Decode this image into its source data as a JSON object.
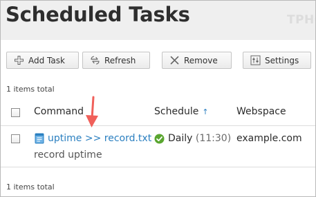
{
  "header": {
    "title": "Scheduled Tasks",
    "watermark": "TPHO"
  },
  "toolbar": {
    "add_label": "Add Task",
    "refresh_label": "Refresh",
    "remove_label": "Remove",
    "settings_label": "Settings"
  },
  "list": {
    "items_total_top": "1 items total",
    "items_total_bottom": "1 items total",
    "columns": {
      "command": "Command",
      "schedule": "Schedule",
      "schedule_sort": "↑",
      "webspace": "Webspace"
    },
    "rows": [
      {
        "command": "uptime >> record.txt",
        "description": "record uptime",
        "schedule": "Daily",
        "schedule_time": "(11:30)",
        "webspace": "example.com"
      }
    ]
  },
  "colors": {
    "link": "#2a7fc0",
    "status_ok": "#5aa630",
    "annotation_arrow": "#f0605a",
    "header_bg": "#efefef"
  },
  "icons": {
    "add": "plus-icon",
    "refresh": "refresh-icon",
    "remove": "close-icon",
    "settings": "sliders-icon",
    "task": "scheduled-task-icon",
    "status": "check-circle-icon",
    "annotation": "arrow-down-icon"
  }
}
